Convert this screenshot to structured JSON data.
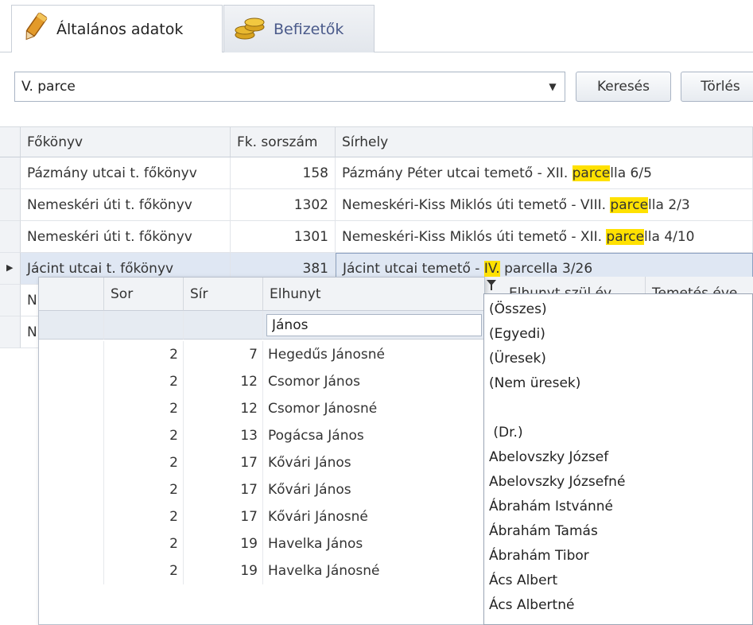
{
  "tabs": [
    {
      "label": "Általános adatok",
      "icon": "pencil-icon"
    },
    {
      "label": "Befizetők",
      "icon": "coins-icon"
    }
  ],
  "search": {
    "value": "V. parce",
    "search_button": "Keresés",
    "clear_button": "Törlés"
  },
  "main_grid": {
    "columns": [
      "Főkönyv",
      "Fk. sorszám",
      "Sírhely"
    ],
    "rows": [
      {
        "fokonyv": "Pázmány utcai t. főkönyv",
        "sorszam": "158",
        "sirhely_pre": "Pázmány Péter utcai temető - XII. ",
        "sirhely_hl": "parce",
        "sirhely_post": "lla 6/5"
      },
      {
        "fokonyv": "Nemeskéri úti t. főkönyv",
        "sorszam": "1302",
        "sirhely_pre": "Nemeskéri-Kiss Miklós úti temető - VIII. ",
        "sirhely_hl": "parce",
        "sirhely_post": "lla 2/3"
      },
      {
        "fokonyv": "Nemeskéri úti t. főkönyv",
        "sorszam": "1301",
        "sirhely_pre": "Nemeskéri-Kiss Miklós úti temető - XII. ",
        "sirhely_hl": "parce",
        "sirhely_post": "lla 4/10"
      },
      {
        "fokonyv": "Jácint utcai t. főkönyv",
        "sorszam": "381",
        "sirhely_pre": "Jácint utcai temető - ",
        "sirhely_hl": "IV.",
        "sirhely_post": " parcella 3/26"
      },
      {
        "fokonyv": "N",
        "sorszam": "",
        "sirhely_pre": "",
        "sirhely_hl": "",
        "sirhely_post": ""
      },
      {
        "fokonyv": "N",
        "sorszam": "",
        "sirhely_pre": "",
        "sirhely_hl": "",
        "sirhely_post": ""
      }
    ]
  },
  "popup_grid": {
    "columns": [
      "",
      "Sor",
      "Sír",
      "Elhunyt"
    ],
    "extra_columns": [
      "Elhunyt szül.év",
      "Temetés éve"
    ],
    "filter_value": "János",
    "rows": [
      {
        "sor": "2",
        "sir": "7",
        "elhunyt": "Hegedűs Jánosné"
      },
      {
        "sor": "2",
        "sir": "12",
        "elhunyt": "Csomor János"
      },
      {
        "sor": "2",
        "sir": "12",
        "elhunyt": "Csomor Jánosné"
      },
      {
        "sor": "2",
        "sir": "13",
        "elhunyt": "Pogácsa János"
      },
      {
        "sor": "2",
        "sir": "17",
        "elhunyt": "Kővári János"
      },
      {
        "sor": "2",
        "sir": "17",
        "elhunyt": "Kővári János"
      },
      {
        "sor": "2",
        "sir": "17",
        "elhunyt": "Kővári Jánosné"
      },
      {
        "sor": "2",
        "sir": "19",
        "elhunyt": "Havelka János"
      },
      {
        "sor": "2",
        "sir": "19",
        "elhunyt": "Havelka Jánosné"
      }
    ]
  },
  "filter_list": {
    "items": [
      "(Összes)",
      "(Egyedi)",
      "(Üresek)",
      "(Nem üresek)",
      "",
      " (Dr.)",
      "Abelovszky József",
      "Abelovszky Józsefné",
      "Ábrahám Istvánné",
      "Ábrahám Tamás",
      "Ábrahám Tibor",
      "Ács Albert",
      "Ács Albertné"
    ]
  },
  "colors": {
    "highlight": "#ffe100",
    "header_bg": "#f1f3f6",
    "border": "#c9cfd8"
  }
}
